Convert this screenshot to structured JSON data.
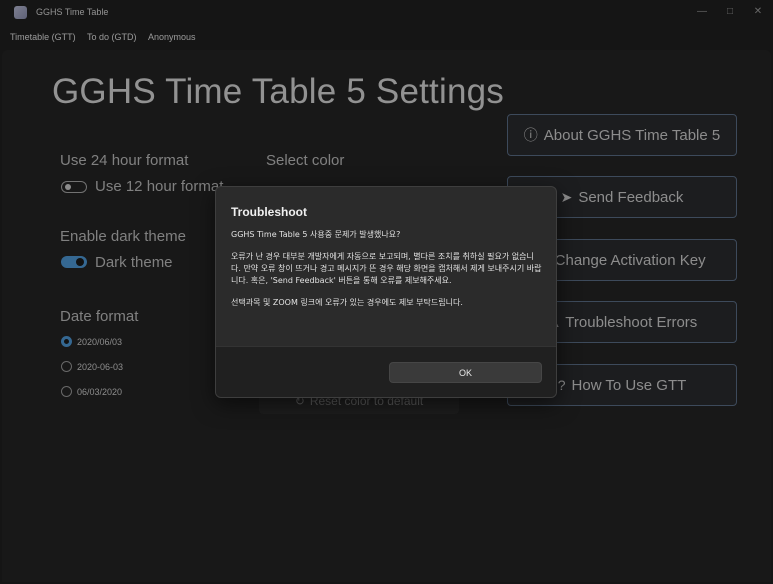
{
  "window": {
    "title": "GGHS Time Table",
    "controls": [
      "minimize-icon",
      "maximize-icon",
      "close-icon"
    ]
  },
  "menu": {
    "items": [
      {
        "label": "Timetable (GTT)"
      },
      {
        "label": "To do (GTD)"
      },
      {
        "label": "Anonymous"
      }
    ],
    "settings_icon": "gear-icon"
  },
  "settings": {
    "title": "GGHS Time Table 5 Settings",
    "time_format": {
      "label": "Use 24 hour format",
      "toggle_text": "Use 12 hour format",
      "on": false
    },
    "color": {
      "label": "Select color",
      "reset_label": "Reset color to default",
      "reset_icon": "refresh-icon"
    },
    "theme": {
      "label": "Enable dark theme",
      "toggle_text": "Dark theme",
      "on": true
    },
    "date_format": {
      "label": "Date format",
      "options": [
        {
          "label": "2020/06/03",
          "checked": true
        },
        {
          "label": "2020-06-03",
          "checked": false
        },
        {
          "label": "06/03/2020",
          "checked": false
        }
      ]
    },
    "actions": [
      {
        "label": "About GGHS Time Table 5",
        "icon": "info-icon"
      },
      {
        "label": "Send Feedback",
        "icon": "send-icon"
      },
      {
        "label": "Change Activation Key",
        "icon": "key-icon"
      },
      {
        "label": "Troubleshoot Errors",
        "icon": "warning-icon"
      },
      {
        "label": "How To Use GTT",
        "icon": "question-icon"
      }
    ]
  },
  "dialog": {
    "title": "Troubleshoot",
    "paragraphs": [
      "GGHS Time Table 5 사용중 문제가 발생했나요?",
      "오류가 난 경우 대부분 개발자에게 자동으로 보고되며, 별다른 조치를 취하실 필요가 없습니다. 만약 오류 창이 뜨거나 경고 메시지가 뜬 경우 해당 화면을 캡처해서 제게 보내주시기 바랍니다. 혹은, 'Send Feedback' 버튼을 통해 오류를 제보해주세요.",
      "선택과목 및 ZOOM 링크에 오류가 있는 경우에도 제보 부탁드립니다."
    ],
    "ok_label": "OK"
  },
  "colors": {
    "accent": "#4f9ad8",
    "background": "#202020",
    "button_border": "#5b6e86"
  }
}
